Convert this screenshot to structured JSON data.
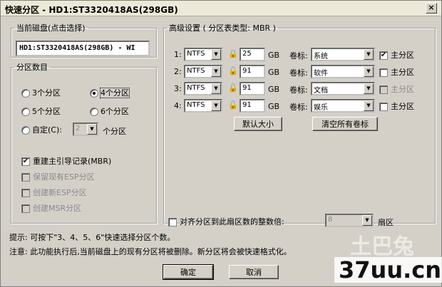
{
  "window": {
    "title": "快速分区 - HD1:ST3320418AS(298GB)",
    "close_glyph": "×"
  },
  "disk_group": {
    "legend": "当前磁盘(点击选择)",
    "value": "HD1:ST3320418AS(298GB) - WI"
  },
  "count_group": {
    "legend": "分区数目",
    "options": [
      "3个分区",
      "4个分区",
      "5个分区",
      "6个分区"
    ],
    "selected": "4个分区",
    "custom_label": "自定(C):",
    "custom_value": "2",
    "custom_suffix": "个分区"
  },
  "options": [
    {
      "label": "重建主引导记录(MBR)",
      "checked": true,
      "enabled": true
    },
    {
      "label": "保留现有ESP分区",
      "checked": false,
      "enabled": false
    },
    {
      "label": "创建新ESP分区",
      "checked": false,
      "enabled": false
    },
    {
      "label": "创建MSR分区",
      "checked": false,
      "enabled": false
    }
  ],
  "advanced": {
    "legend": "高级设置 ( 分区表类型: MBR )",
    "unit": "GB",
    "volume_label": "卷标:",
    "primary_label": "主分区",
    "rows": [
      {
        "index": "1:",
        "fs": "NTFS",
        "size": "25",
        "label": "系统",
        "primary": true,
        "primary_enabled": true
      },
      {
        "index": "2:",
        "fs": "NTFS",
        "size": "91",
        "label": "软件",
        "primary": false,
        "primary_enabled": true
      },
      {
        "index": "3:",
        "fs": "NTFS",
        "size": "91",
        "label": "文档",
        "primary": false,
        "primary_enabled": false
      },
      {
        "index": "4:",
        "fs": "NTFS",
        "size": "91",
        "label": "娱乐",
        "primary": false,
        "primary_enabled": true
      }
    ],
    "default_size_button": "默认大小",
    "clear_labels_button": "清空所有卷标",
    "align_label": "对齐分区到此扇区数的整数倍:",
    "align_value": "8",
    "align_suffix": "扇区"
  },
  "tips": {
    "tip": "提示: 可按下\"3、4、5、6\"快速选择分区个数。",
    "note": "注意: 此功能执行后,当前磁盘上的现有分区将被删除。新分区将会被快速格式化。"
  },
  "buttons": {
    "ok": "确定",
    "cancel": "取消"
  },
  "watermark": {
    "faded": "土巴兔",
    "site": "37uu.cn"
  }
}
